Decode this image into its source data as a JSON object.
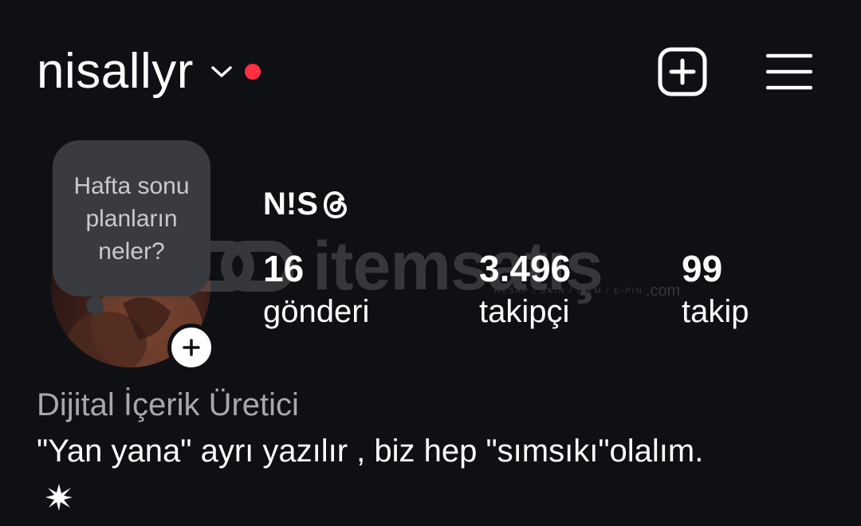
{
  "header": {
    "username": "nisallyr",
    "icons": {
      "dropdown": "chevron-down-icon",
      "notification": "notification-dot",
      "create": "plus-square-icon",
      "menu": "hamburger-menu-icon"
    }
  },
  "profile": {
    "note": "Hafta sonu planların neler?",
    "display_name": "N!S",
    "threads_icon": "threads-icon",
    "stats": [
      {
        "value": "16",
        "label": "gönderi"
      },
      {
        "value": "3.496",
        "label": "takipçi"
      },
      {
        "value": "99",
        "label": "takip"
      }
    ],
    "category": "Dijital İçerik Üretici",
    "bio": "\"Yan yana\" ayrı yazılır , biz hep \"sımsıkı\"olalım.",
    "bio_icon": "sparkle-icon"
  },
  "watermark": {
    "brand": "itemsatış",
    "tagline": "HESAP / SKIN / ITEM / E-PIN",
    "suffix": ".com"
  },
  "colors": {
    "background": "#0f1014",
    "notification_dot": "#ff3040",
    "note_bubble": "#3a3b40",
    "secondary_text": "#a8a8ad"
  }
}
